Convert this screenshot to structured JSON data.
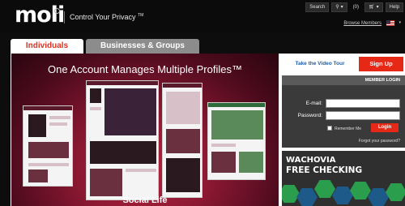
{
  "header": {
    "logo": "moli",
    "tagline": "Control Your Privacy",
    "tagline_mark": "TM",
    "topbar": {
      "search_label": "Search",
      "search_dropdown": "▾",
      "count": "(0)",
      "cart_caret": "▾",
      "help": "Help"
    },
    "browse_members": "Browse Members",
    "flag_caret": "▾"
  },
  "tabs": [
    {
      "label": "Individuals",
      "active": true
    },
    {
      "label": "Businesses & Groups",
      "active": false
    }
  ],
  "hero": {
    "headline": "One Account Manages Multiple Profiles™",
    "caption": "Social Life"
  },
  "sidebar": {
    "video_tour": "Take the Video Tour",
    "sign_up": "Sign Up",
    "login": {
      "title": "MEMBER LOGIN",
      "email_label": "E-mail:",
      "password_label": "Password:",
      "remember_me": "Remember Me",
      "login_button": "Login",
      "forgot_password": "Forgot your password?"
    },
    "ad": {
      "line1": "WACHOVIA",
      "line2": "FREE CHECKING"
    }
  },
  "colors": {
    "accent": "#e62816",
    "tab_inactive": "#8c8c8c",
    "link": "#1f5fa8"
  }
}
